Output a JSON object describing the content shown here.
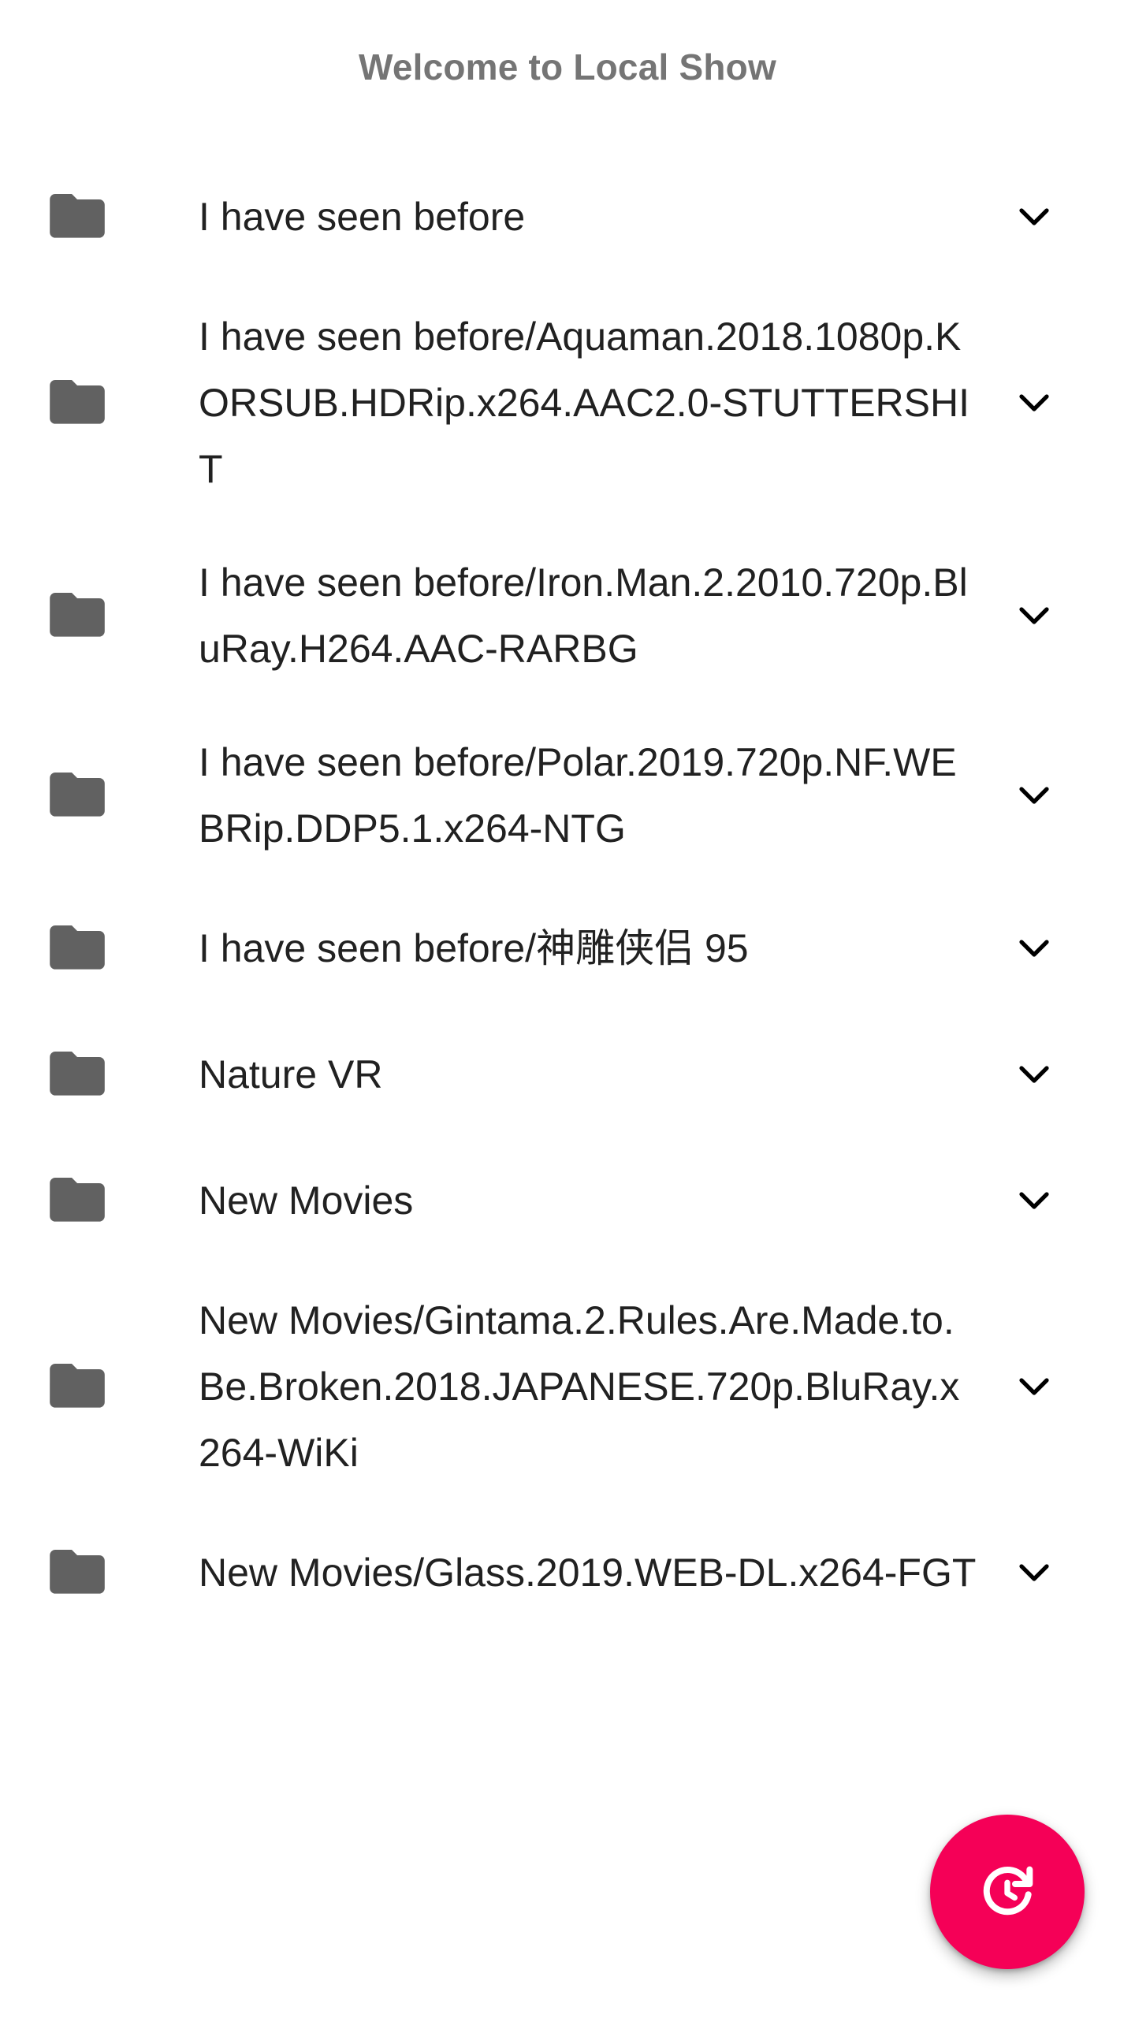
{
  "header": {
    "title": "Welcome to Local Show"
  },
  "folders": [
    {
      "label": "I have seen before",
      "icon": "folder-icon"
    },
    {
      "label": "I have seen before/Aquaman.2018.1080p.KORSUB.HDRip.x264.AAC2.0-STUTTERSHIT",
      "icon": "folder-icon"
    },
    {
      "label": "I have seen before/Iron.Man.2.2010.720p.BluRay.H264.AAC-RARBG",
      "icon": "folder-icon"
    },
    {
      "label": "I have seen before/Polar.2019.720p.NF.WEBRip.DDP5.1.x264-NTG",
      "icon": "folder-icon"
    },
    {
      "label": "I have seen before/神雕侠侣 95",
      "icon": "folder-icon"
    },
    {
      "label": "Nature VR",
      "icon": "folder-icon"
    },
    {
      "label": "New Movies",
      "icon": "folder-icon"
    },
    {
      "label": "New Movies/Gintama.2.Rules.Are.Made.to.Be.Broken.2018.JAPANESE.720p.BluRay.x264-WiKi",
      "icon": "folder-icon"
    },
    {
      "label": "New Movies/Glass.2019.WEB-DL.x264-FGT",
      "icon": "folder-icon"
    }
  ],
  "fab": {
    "icon": "refresh-icon",
    "color": "#f50057"
  },
  "colors": {
    "folder_icon": "#616161",
    "title_text": "#757575",
    "label_text": "#212121"
  }
}
